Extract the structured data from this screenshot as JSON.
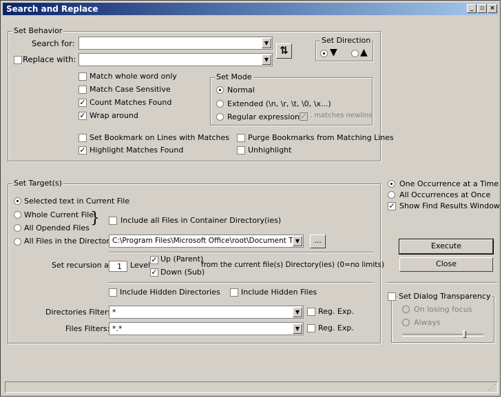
{
  "window": {
    "title": "Search and Replace",
    "controls": [
      "_",
      "▫",
      "×"
    ]
  },
  "behavior": {
    "group_label": "Set Behavior",
    "search_label": "Search for:",
    "search_value": "",
    "replace_label": "Replace with:",
    "replace_value": "",
    "replace_checked": false,
    "match_whole_word": "Match whole word only",
    "match_case": "Match Case Sensitive",
    "count_matches": "Count Matches Found",
    "wrap_around": "Wrap around",
    "set_bookmark": "Set Bookmark on Lines with Matches",
    "highlight": "Highlight Matches Found",
    "purge_bookmarks": "Purge Bookmarks from Matching Lines",
    "unhighlight": "Unhighlight",
    "swap_icon": "⇅"
  },
  "direction": {
    "label": "Set Direction",
    "down": "▼",
    "up": "▲"
  },
  "mode": {
    "label": "Set Mode",
    "normal": "Normal",
    "extended": "Extended (\\n, \\r, \\t, \\0, \\x...)",
    "regex": "Regular expression",
    "matches_newline": ". matches newline"
  },
  "target": {
    "label": "Set Target(s)",
    "selected_text": "Selected text in Current File",
    "whole_file": "Whole Current File",
    "all_opened": "All Opended Files",
    "all_in_dir": "All Files in the Directory:",
    "include_container": "Include all Files in Container Directory(ies)",
    "directory_value": "C:\\Program Files\\Microsoft Office\\root\\Document Then",
    "browse_label": "...",
    "recursion_label": "Set recursion at:",
    "recursion_value": "1",
    "level_label": "Level",
    "up_label": "Up (Parent)",
    "down_label": "Down (Sub)",
    "recursion_suffix": "from the current file(s) Directory(ies) (0=no limits)",
    "hidden_dirs": "Include Hidden Directories",
    "hidden_files": "Include Hidden Files",
    "dir_filter_label": "Directories Filters:",
    "dir_filter_value": "*",
    "file_filter_label": "Files Filters:",
    "file_filter_value": "*.*",
    "regexp_label": "Reg. Exp."
  },
  "options": {
    "one_occurrence": "One Occurrence at a Time",
    "all_occurrences": "All Occurrences at Once",
    "show_results": "Show Find Results Window",
    "execute": "Execute",
    "close": "Close"
  },
  "transparency": {
    "label": "Set Dialog Transparency",
    "on_losing_focus": "On losing focus",
    "always": "Always",
    "slider_level": 0.78
  }
}
